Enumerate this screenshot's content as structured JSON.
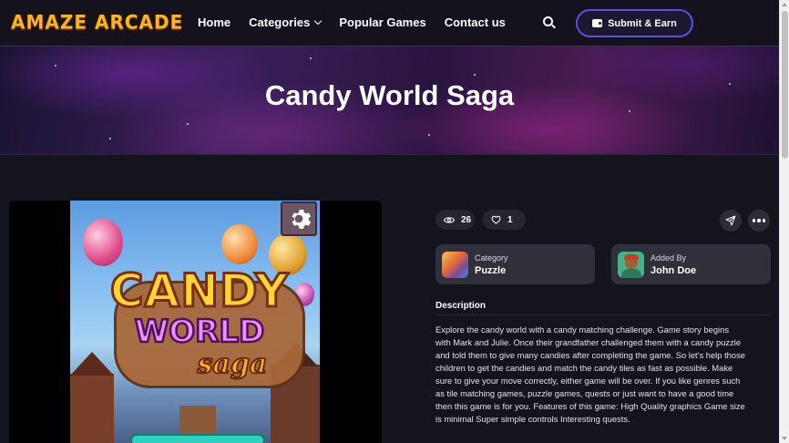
{
  "header": {
    "logo_text": "AMAZE ARCADE",
    "nav": [
      {
        "label": "Home"
      },
      {
        "label": "Categories"
      },
      {
        "label": "Popular Games"
      },
      {
        "label": "Contact us"
      }
    ],
    "search_icon": "search-icon",
    "submit_label": "Submit & Earn",
    "submit_icon": "wallet-icon"
  },
  "hero": {
    "title": "Candy World Saga"
  },
  "game": {
    "logo_line1": "CANDY",
    "logo_line2": "WORLD",
    "logo_line3": "saga",
    "settings_icon": "gear-icon"
  },
  "stats": {
    "views": "26",
    "likes": "1",
    "views_icon": "eye-icon",
    "likes_icon": "heart-icon",
    "share_icon": "send-icon",
    "more_icon": "more-dots-icon"
  },
  "category": {
    "label": "Category",
    "value": "Puzzle"
  },
  "added_by": {
    "label": "Added By",
    "value": "John Doe"
  },
  "description": {
    "title": "Description",
    "body": "Explore the candy world with a candy matching challenge. Game story begins with Mark and Julie. Once their grandfather challenged them with a candy puzzle and told them to give many candies after completing the game. So let's help those children to get the candies and match the candy tiles as fast as possible. Make sure to give your move correctly, either game will be over. If you like genres such as tile matching games, puzzle games, quests or just want to have a good time then this game is for you. Features of this game: High Quality graphics Game size is minimal Super simple controls Interesting quests."
  },
  "colors": {
    "background": "#14151c",
    "accent_border": "#5b4fdc",
    "card": "#2f3039",
    "logo_gold": "#f6b623"
  }
}
